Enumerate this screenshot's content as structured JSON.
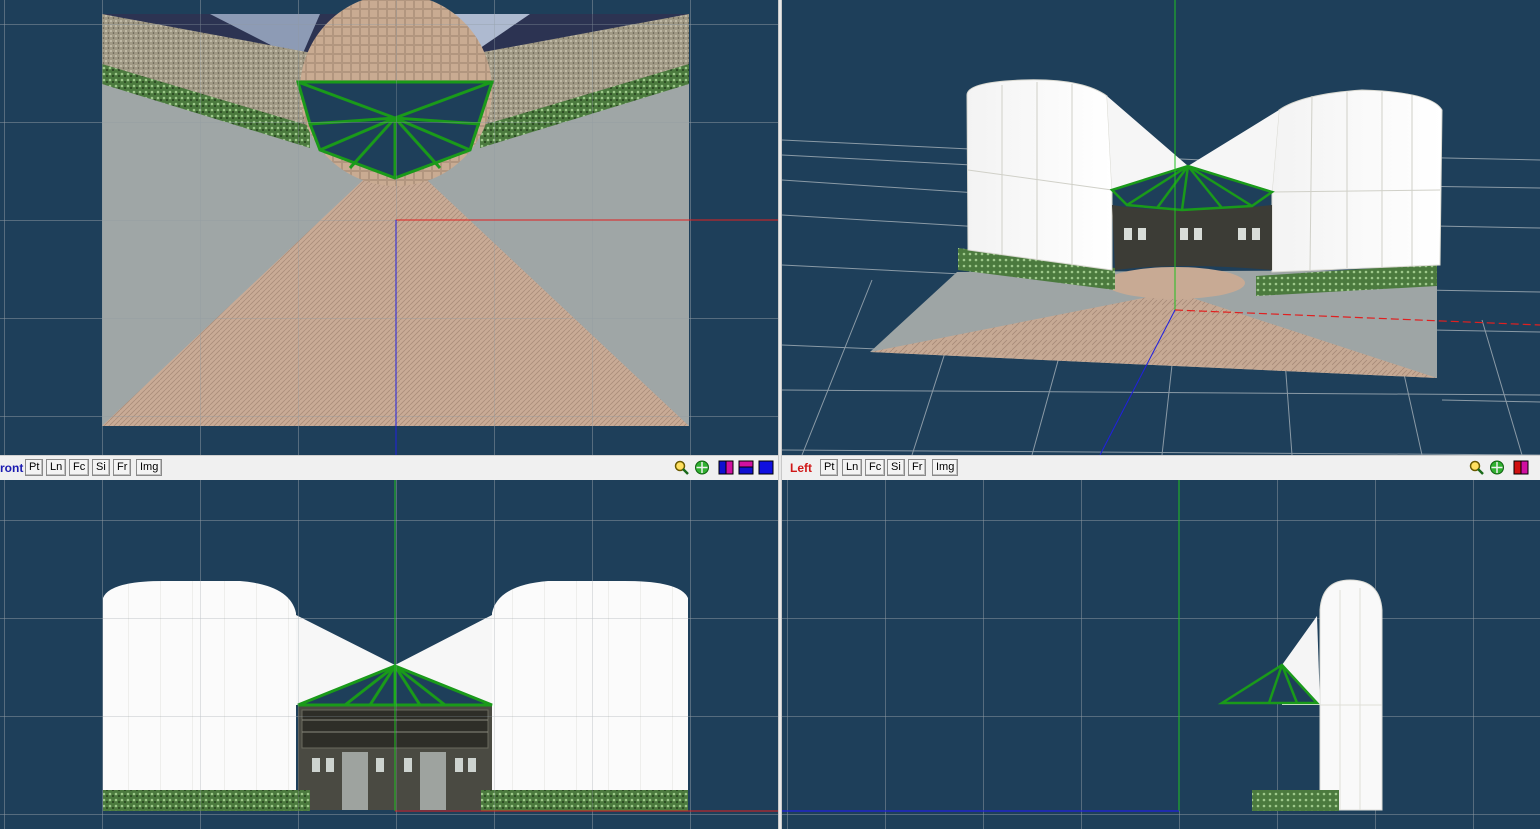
{
  "views": {
    "top": {
      "name": ""
    },
    "perspective": {
      "name": ""
    },
    "front": {
      "name": "ront"
    },
    "left": {
      "name": "Left"
    }
  },
  "toolbar": {
    "buttons": [
      "Pt",
      "Ln",
      "Fc",
      "Si",
      "Fr",
      "Img"
    ]
  },
  "icons": [
    "zoom-icon",
    "pan-icon",
    "color-mode-icon",
    "material-icon",
    "solid-color-icon"
  ],
  "colors": {
    "viewport_bg": "#1e3f5a",
    "grid": "#8a9aa6",
    "axis_x": "#e02020",
    "axis_y": "#20c020",
    "axis_z": "#2020e0",
    "front_label": "#1a1ab0",
    "left_label": "#d01818",
    "selection": "#1a9a1a"
  }
}
